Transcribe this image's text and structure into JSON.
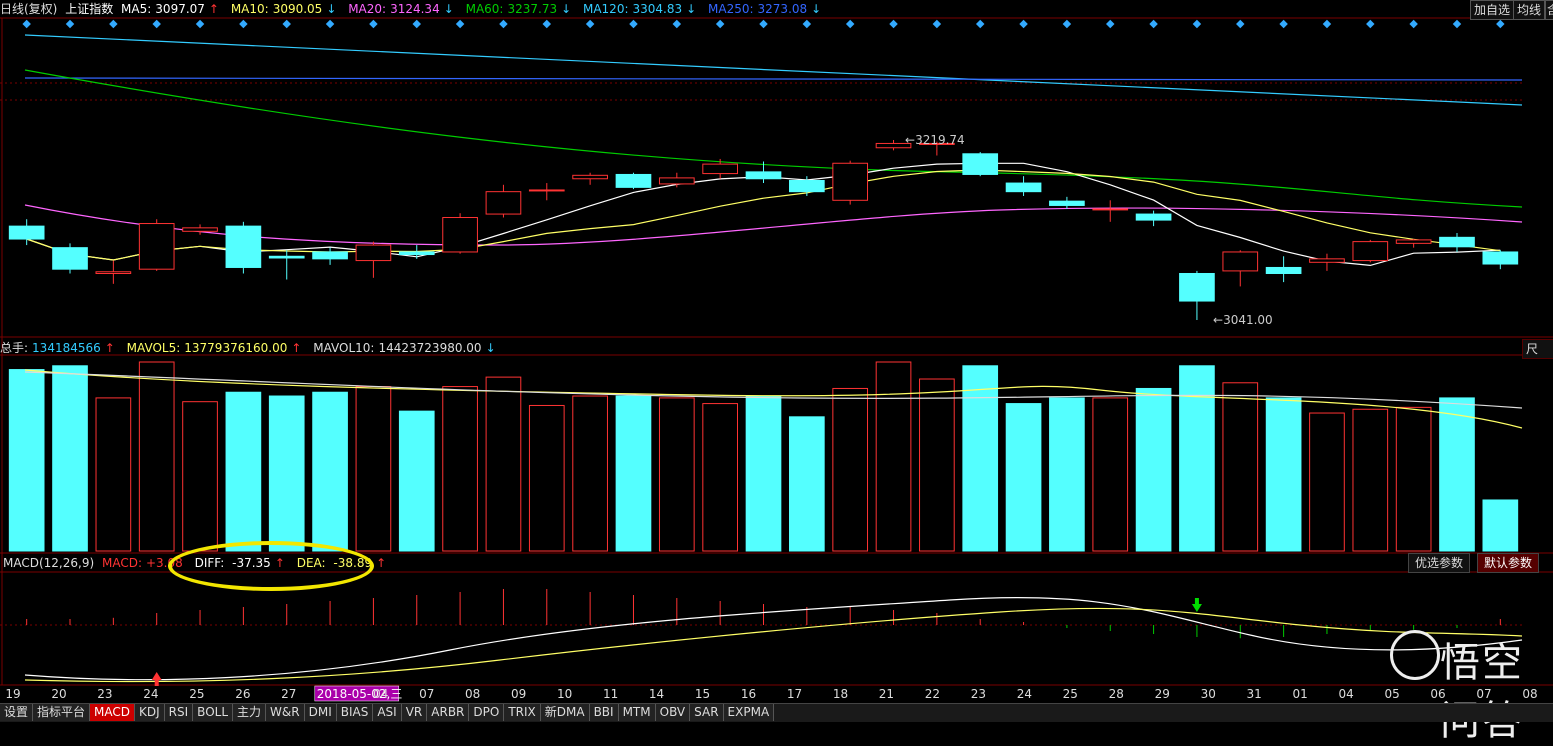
{
  "header": {
    "title": "日线(复权)",
    "symbol": "上证指数",
    "ma5_label": "MA5:",
    "ma5_value": "3097.07",
    "ma10_label": "MA10:",
    "ma10_value": "3090.05",
    "ma20_label": "MA20:",
    "ma20_value": "3124.34",
    "ma60_label": "MA60:",
    "ma60_value": "3237.73",
    "ma120_label": "MA120:",
    "ma120_value": "3304.83",
    "ma250_label": "MA250:",
    "ma250_value": "3273.08",
    "btn_add": "加自选",
    "btn_ma": "均线",
    "btn_more": "含"
  },
  "annotations": {
    "high": "3219.74",
    "low": "3041.00"
  },
  "volume": {
    "total_label": "总手:",
    "total_value": "134184566",
    "mavol5_label": "MAVOL5:",
    "mavol5_value": "13779376160.00",
    "mavol10_label": "MAVOL10:",
    "mavol10_value": "14423723980.00",
    "right_btn": "尺"
  },
  "macd": {
    "title": "MACD(12,26,9)",
    "macd_label": "MACD:",
    "macd_value": "+3.08",
    "diff_label": "DIFF:",
    "diff_value": "-37.35",
    "dea_label": "DEA:",
    "dea_value": "-38.89",
    "optimize": "优选参数",
    "default": "默认参数"
  },
  "xaxis": {
    "labels": [
      "19",
      "20",
      "23",
      "24",
      "25",
      "26",
      "27",
      "2018-05-02,三",
      "04",
      "07",
      "08",
      "09",
      "10",
      "11",
      "14",
      "15",
      "16",
      "17",
      "18",
      "21",
      "22",
      "23",
      "24",
      "25",
      "28",
      "29",
      "30",
      "31",
      "01",
      "04",
      "05",
      "06",
      "07",
      "08"
    ]
  },
  "tabs": [
    "设置",
    "指标平台",
    "MACD",
    "KDJ",
    "RSI",
    "BOLL",
    "主力",
    "W&R",
    "DMI",
    "BIAS",
    "ASI",
    "VR",
    "ARBR",
    "DPO",
    "TRIX",
    "新DMA",
    "BBI",
    "MTM",
    "OBV",
    "SAR",
    "EXPMA"
  ],
  "active_tab": "MACD",
  "watermark": "悟空问答",
  "colors": {
    "up": "#ff3333",
    "down": "#54ffff",
    "ma5": "#ffffff",
    "ma10": "#ffff66",
    "ma20": "#ff66ff",
    "ma60": "#00cc00",
    "ma120": "#33ccff",
    "ma250": "#3366ff"
  },
  "chart_data": {
    "type": "candlestick",
    "candles": [
      {
        "o": 3150,
        "c": 3135,
        "h": 3158,
        "l": 3128
      },
      {
        "o": 3125,
        "c": 3100,
        "h": 3130,
        "l": 3095
      },
      {
        "o": 3095,
        "c": 3097,
        "h": 3110,
        "l": 3083
      },
      {
        "o": 3100,
        "c": 3153,
        "h": 3158,
        "l": 3098
      },
      {
        "o": 3144,
        "c": 3148,
        "h": 3152,
        "l": 3140
      },
      {
        "o": 3150,
        "c": 3102,
        "h": 3155,
        "l": 3095
      },
      {
        "o": 3115,
        "c": 3113,
        "h": 3122,
        "l": 3088
      },
      {
        "o": 3120,
        "c": 3112,
        "h": 3125,
        "l": 3105
      },
      {
        "o": 3110,
        "c": 3128,
        "h": 3132,
        "l": 3090
      },
      {
        "o": 3120,
        "c": 3117,
        "h": 3128,
        "l": 3112
      },
      {
        "o": 3120,
        "c": 3160,
        "h": 3165,
        "l": 3118
      },
      {
        "o": 3164,
        "c": 3190,
        "h": 3198,
        "l": 3160
      },
      {
        "o": 3192,
        "c": 3192,
        "h": 3200,
        "l": 3180
      },
      {
        "o": 3205,
        "c": 3209,
        "h": 3212,
        "l": 3198
      },
      {
        "o": 3210,
        "c": 3195,
        "h": 3212,
        "l": 3193
      },
      {
        "o": 3199,
        "c": 3206,
        "h": 3212,
        "l": 3195
      },
      {
        "o": 3211,
        "c": 3222,
        "h": 3228,
        "l": 3205
      },
      {
        "o": 3213,
        "c": 3205,
        "h": 3225,
        "l": 3200
      },
      {
        "o": 3203,
        "c": 3190,
        "h": 3208,
        "l": 3185
      },
      {
        "o": 3180,
        "c": 3223,
        "h": 3226,
        "l": 3175
      },
      {
        "o": 3241,
        "c": 3246,
        "h": 3250,
        "l": 3238
      },
      {
        "o": 3246,
        "c": 3246,
        "h": 3248,
        "l": 3232
      },
      {
        "o": 3234,
        "c": 3210,
        "h": 3236,
        "l": 3208
      },
      {
        "o": 3200,
        "c": 3190,
        "h": 3208,
        "l": 3185
      },
      {
        "o": 3179,
        "c": 3174,
        "h": 3184,
        "l": 3170
      },
      {
        "o": 3170,
        "c": 3170,
        "h": 3180,
        "l": 3155
      },
      {
        "o": 3164,
        "c": 3157,
        "h": 3168,
        "l": 3150
      },
      {
        "o": 3095,
        "c": 3063,
        "h": 3098,
        "l": 3041
      },
      {
        "o": 3098,
        "c": 3120,
        "h": 3122,
        "l": 3080
      },
      {
        "o": 3102,
        "c": 3095,
        "h": 3115,
        "l": 3085
      },
      {
        "o": 3108,
        "c": 3112,
        "h": 3118,
        "l": 3098
      },
      {
        "o": 3110,
        "c": 3132,
        "h": 3134,
        "l": 3108
      },
      {
        "o": 3130,
        "c": 3134,
        "h": 3135,
        "l": 3125
      },
      {
        "o": 3137,
        "c": 3126,
        "h": 3142,
        "l": 3120
      },
      {
        "o": 3120,
        "c": 3106,
        "h": 3122,
        "l": 3100
      }
    ],
    "volume_ratio": [
      0.96,
      0.98,
      0.81,
      1.0,
      0.79,
      0.84,
      0.82,
      0.84,
      0.87,
      0.74,
      0.87,
      0.92,
      0.77,
      0.82,
      0.82,
      0.81,
      0.78,
      0.82,
      0.71,
      0.86,
      1.0,
      0.91,
      0.98,
      0.78,
      0.81,
      0.81,
      0.86,
      0.98,
      0.89,
      0.81,
      0.73,
      0.75,
      0.76,
      0.81,
      0.27
    ]
  }
}
